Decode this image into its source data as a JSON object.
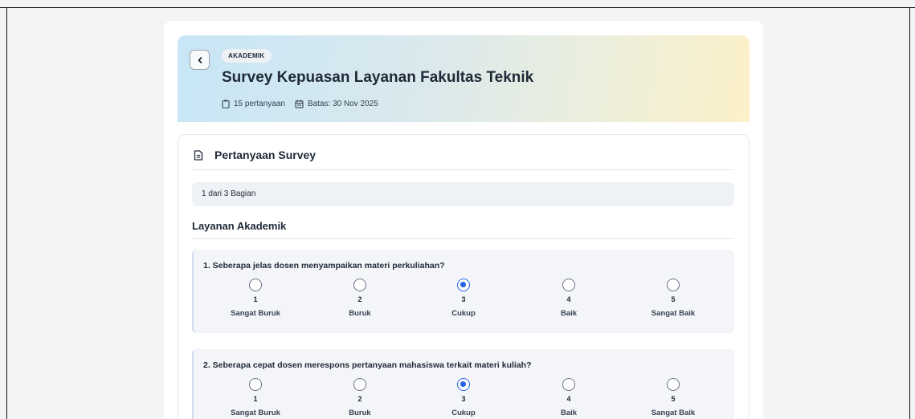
{
  "header": {
    "badge": "AKADEMIK",
    "title": "Survey Kepuasan Layanan Fakultas Teknik",
    "question_count": "15 pertanyaan",
    "deadline": "Batas: 30 Nov 2025"
  },
  "panel": {
    "heading": "Pertanyaan Survey",
    "progress_text": "1 dari 3 Bagian",
    "section_title": "Layanan Akademik"
  },
  "questions": [
    {
      "text": "1. Seberapa jelas dosen menyampaikan materi perkuliahan?",
      "selected": 3
    },
    {
      "text": "2. Seberapa cepat dosen merespons pertanyaan mahasiswa terkait materi kuliah?",
      "selected": 3
    }
  ],
  "scale": [
    {
      "num": "1",
      "label": "Sangat Buruk"
    },
    {
      "num": "2",
      "label": "Buruk"
    },
    {
      "num": "3",
      "label": "Cukup"
    },
    {
      "num": "4",
      "label": "Baik"
    },
    {
      "num": "5",
      "label": "Sangat Baik"
    }
  ],
  "colors": {
    "accent": "#2563eb",
    "hero_start": "#c7e6f6",
    "hero_end": "#fbf0c8"
  }
}
